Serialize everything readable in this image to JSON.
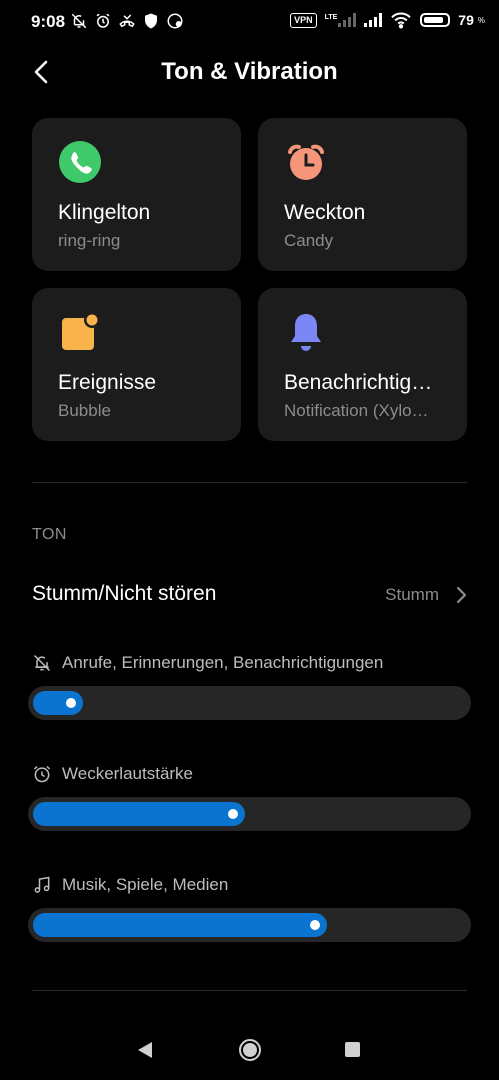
{
  "status_bar": {
    "time": "9:08",
    "vpn": "VPN",
    "network": "LTE",
    "battery_level": "79",
    "battery_unit": "%"
  },
  "header": {
    "title": "Ton & Vibration"
  },
  "cards": [
    {
      "name": "Klingelton",
      "value": "ring-ring",
      "icon": "phone-icon",
      "color": "#3ec96a"
    },
    {
      "name": "Weckton",
      "value": "Candy",
      "icon": "alarm-clock-icon",
      "color": "#f5957a"
    },
    {
      "name": "Ereignisse",
      "value": "Bubble",
      "icon": "event-icon",
      "color": "#f8b34c"
    },
    {
      "name": "Benachrichtig…",
      "value": "Notification (Xylo…",
      "icon": "bell-icon",
      "color": "#7b86f5"
    }
  ],
  "section": {
    "title": "TON"
  },
  "dnd": {
    "label": "Stumm/Nicht stören",
    "value": "Stumm"
  },
  "volumes": [
    {
      "label": "Anrufe, Erinnerungen, Benachrichtigungen",
      "icon": "bell-off-icon",
      "level": 0.08
    },
    {
      "label": "Weckerlautstärke",
      "icon": "alarm-clock-icon",
      "level": 0.49
    },
    {
      "label": "Musik, Spiele, Medien",
      "icon": "music-note-icon",
      "level": 0.68
    }
  ],
  "colors": {
    "accent": "#0a74d0",
    "card_bg": "#1c1c1c",
    "background": "#000000"
  }
}
